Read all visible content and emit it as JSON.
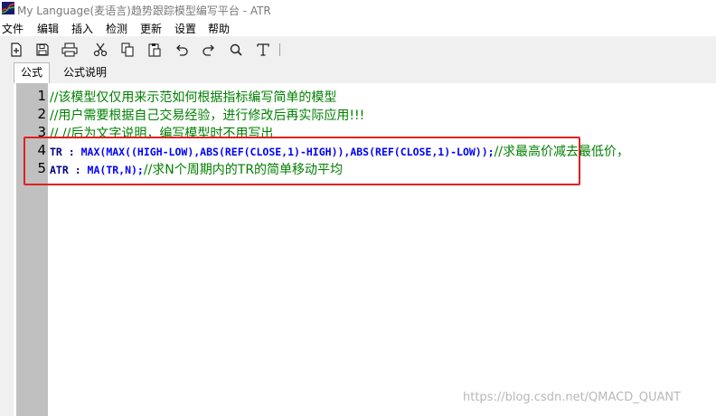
{
  "window": {
    "title": "My Language(麦语言)趋势跟踪模型编写平台 - ATR"
  },
  "menu": {
    "items": [
      "文件",
      "编辑",
      "插入",
      "检测",
      "更新",
      "设置",
      "帮助"
    ]
  },
  "toolbar": {
    "icons": [
      "new-file-icon",
      "save-icon",
      "print-icon",
      "cut-icon",
      "copy-icon",
      "paste-icon",
      "undo-icon",
      "redo-icon",
      "search-icon",
      "text-icon"
    ]
  },
  "tabs": [
    {
      "label": "公式",
      "active": true
    },
    {
      "label": "公式说明",
      "active": false
    }
  ],
  "editor": {
    "lines": [
      {
        "num": "1",
        "text": "//该模型仅仅用来示范如何根据指标编写简单的模型"
      },
      {
        "num": "2",
        "text": "//用户需要根据自己交易经验，进行修改后再实际应用!!!"
      },
      {
        "num": "3",
        "text": "// //后为文字说明，编写模型时不用写出"
      },
      {
        "num": "4",
        "text": "TR : MAX(MAX((HIGH-LOW),ABS(REF(CLOSE,1)-HIGH)),ABS(REF(CLOSE,1)-LOW));//求最高价减去最低价，"
      },
      {
        "num": "5",
        "text": "ATR : MA(TR,N);//求N个周期内的TR的简单移动平均"
      }
    ],
    "line4": {
      "seg1": "TR : ",
      "seg2": "MAX(MAX((HIGH-LOW),ABS(REF(CLOSE,1)-HIGH)),ABS(REF(CLOSE,1)-LOW));",
      "seg3": "//求最高价减去最低价，"
    },
    "line5": {
      "seg1": "ATR : ",
      "seg2": "MA(TR,N);",
      "seg3": "//求N个周期内的TR的简单移动平均"
    }
  },
  "watermark": "https://blog.csdn.net/QMACD_QUANT",
  "colors": {
    "comment": "#008000",
    "keyword": "#000080",
    "function": "#0000ff",
    "gutter": "#c0c0c0",
    "highlight": "#e02020"
  }
}
